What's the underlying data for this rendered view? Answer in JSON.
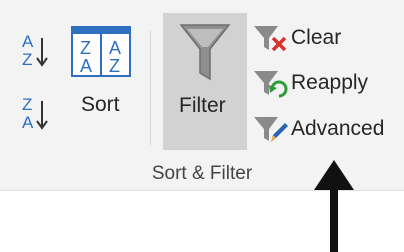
{
  "ribbon": {
    "group_label": "Sort & Filter",
    "sort_az": {
      "top": "A",
      "bottom": "Z",
      "icon": "sort-ascending-icon"
    },
    "sort_za": {
      "top": "Z",
      "bottom": "A",
      "icon": "sort-descending-icon"
    },
    "sort_dialog": {
      "label": "Sort",
      "grid_letters": [
        "Z",
        "A",
        "A",
        "Z"
      ],
      "icon": "sort-dialog-icon"
    },
    "filter": {
      "label": "Filter",
      "icon": "funnel-icon",
      "active": true
    },
    "clear": {
      "label": "Clear",
      "icon": "clear-filter-icon"
    },
    "reapply": {
      "label": "Reapply",
      "icon": "reapply-filter-icon"
    },
    "advanced": {
      "label": "Advanced",
      "icon": "advanced-filter-icon"
    }
  },
  "colors": {
    "ribbon_bg": "#f3f3f3",
    "filter_pressed_bg": "#d2d2d2",
    "sort_blue": "#2e6fc0",
    "clear_red": "#d2352b",
    "reapply_green": "#2f9a3b",
    "advanced_blue": "#2a64b0"
  }
}
